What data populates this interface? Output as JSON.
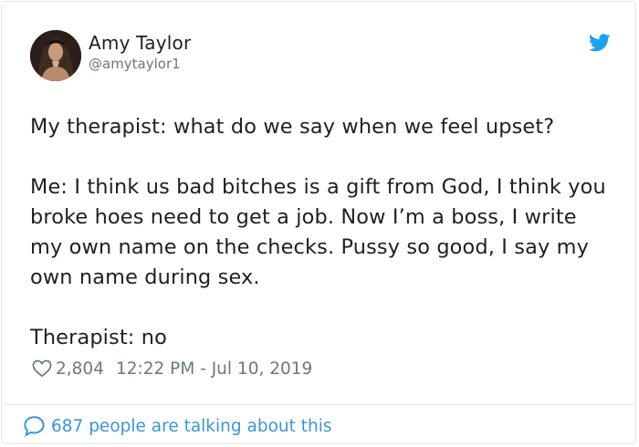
{
  "author": {
    "display_name": "Amy Taylor",
    "handle": "@amytaylor1"
  },
  "tweet": {
    "paragraphs": [
      "My therapist:  what do we say when we feel upset?",
      "Me:  I think us bad bitches is a gift from God, I think you broke hoes need to get a job.  Now I’m a boss, I write my own name on the checks.  Pussy so good, I say my own name during sex.",
      "Therapist:  no"
    ]
  },
  "meta": {
    "likes": "2,804",
    "timestamp": "12:22 PM - Jul 10, 2019"
  },
  "footer": {
    "talking": "687 people are talking about this"
  },
  "icons": {
    "brand": "twitter-bird-icon",
    "like": "heart-icon",
    "reply": "speech-bubble-icon"
  },
  "colors": {
    "text": "#1c2022",
    "muted": "#697882",
    "link": "#3b94d9",
    "brand": "#1da1f2",
    "border": "#e1e8ed"
  }
}
